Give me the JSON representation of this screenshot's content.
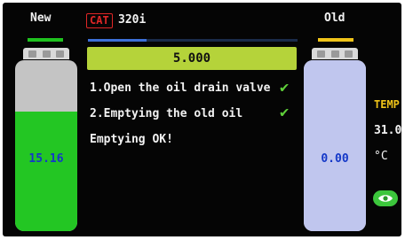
{
  "header": {
    "new_label": "New",
    "old_label": "Old",
    "brand_badge": "CAT",
    "model": "320i"
  },
  "process": {
    "value": "5.000",
    "progress": 0.28,
    "steps": [
      {
        "text": "1.Open the oil drain valve",
        "done": true
      },
      {
        "text": "2.Emptying the old oil",
        "done": true
      },
      {
        "text": "Emptying OK!",
        "done": false
      }
    ]
  },
  "bottles": {
    "new": {
      "value": "15.16",
      "level": 0.7
    },
    "old": {
      "value": "0.00",
      "level": 0.0
    }
  },
  "temperature": {
    "label": "TEMP",
    "value": "31.0",
    "unit": "°C"
  },
  "colors": {
    "new_accent": "#1fc21f",
    "old_accent": "#f0c419",
    "value_box": "#b5d33a",
    "check": "#5fd03a"
  }
}
